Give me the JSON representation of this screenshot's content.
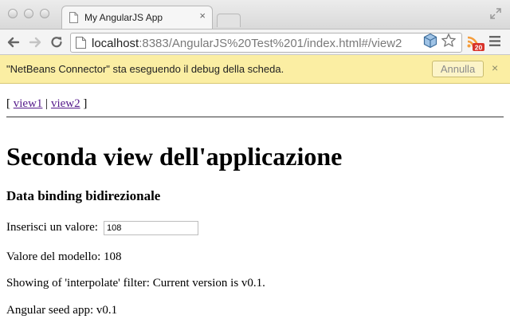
{
  "browser": {
    "tab_title": "My AngularJS App",
    "url_host": "localhost",
    "url_rest": ":8383/AngularJS%20Test%201/index.html#/view2",
    "extension_badge": "20"
  },
  "infobar": {
    "message": "\"NetBeans Connector\" sta eseguendo il debug della scheda.",
    "cancel_label": "Annulla"
  },
  "page": {
    "nav": {
      "open": "[ ",
      "view1": "view1",
      "sep": " | ",
      "view2": "view2",
      "close": " ]"
    },
    "heading": "Seconda view dell'applicazione",
    "subheading": "Data binding bidirezionale",
    "input_label": "Inserisci un valore:",
    "input_value": "108",
    "model_line": "Valore del modello: 108",
    "filter_line": "Showing of 'interpolate' filter: Current version is v0.1.",
    "footer_line": "Angular seed app: v0.1"
  },
  "colors": {
    "infobar_bg": "#fbeea3",
    "link_visited": "#551a8b"
  }
}
